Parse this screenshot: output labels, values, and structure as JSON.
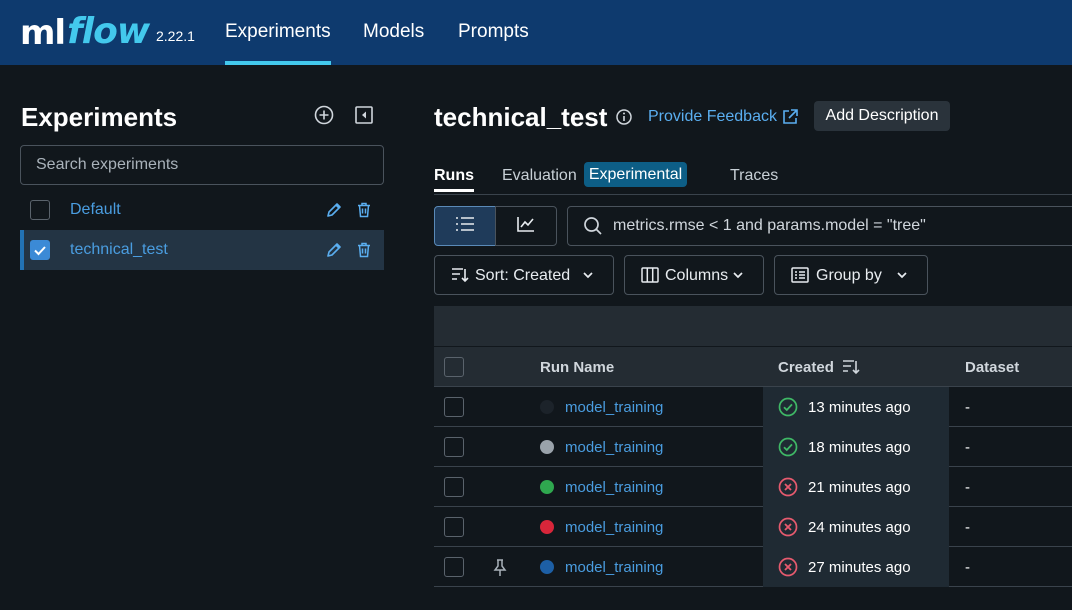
{
  "nav": {
    "logo_ml": "ml",
    "logo_flow": "flow",
    "version": "2.22.1",
    "items": [
      {
        "label": "Experiments",
        "active": true
      },
      {
        "label": "Models",
        "active": false
      },
      {
        "label": "Prompts",
        "active": false
      }
    ]
  },
  "sidebar": {
    "title": "Experiments",
    "search_placeholder": "Search experiments",
    "experiments": [
      {
        "name": "Default",
        "checked": false
      },
      {
        "name": "technical_test",
        "checked": true
      }
    ]
  },
  "main": {
    "title": "technical_test",
    "feedback_label": "Provide Feedback",
    "add_description_label": "Add Description",
    "tabs": [
      {
        "label": "Runs",
        "active": true
      },
      {
        "label": "Evaluation",
        "active": false
      },
      {
        "label": "Traces",
        "active": false
      }
    ],
    "experimental_badge": "Experimental",
    "search_placeholder": "metrics.rmse < 1 and params.model = \"tree\"",
    "sort_label": "Sort: Created",
    "columns_label": "Columns",
    "group_by_label": "Group by"
  },
  "table": {
    "headers": {
      "run_name": "Run Name",
      "created": "Created",
      "dataset": "Dataset"
    },
    "rows": [
      {
        "name": "model_training",
        "color": "#1c232a",
        "status": "success",
        "created": "13 minutes ago",
        "dataset": "-",
        "pinned": false
      },
      {
        "name": "model_training",
        "color": "#9aa3ab",
        "status": "success",
        "created": "18 minutes ago",
        "dataset": "-",
        "pinned": false
      },
      {
        "name": "model_training",
        "color": "#2fa84f",
        "status": "failed",
        "created": "21 minutes ago",
        "dataset": "-",
        "pinned": false
      },
      {
        "name": "model_training",
        "color": "#d8263a",
        "status": "failed",
        "created": "24 minutes ago",
        "dataset": "-",
        "pinned": false
      },
      {
        "name": "model_training",
        "color": "#1d5fa5",
        "status": "failed",
        "created": "27 minutes ago",
        "dataset": "-",
        "pinned": true
      }
    ]
  },
  "colors": {
    "topbar": "#0e3a6e",
    "accent": "#43c9ed",
    "link": "#4a9de0",
    "success": "#3fb866",
    "failed": "#e65a6e"
  }
}
